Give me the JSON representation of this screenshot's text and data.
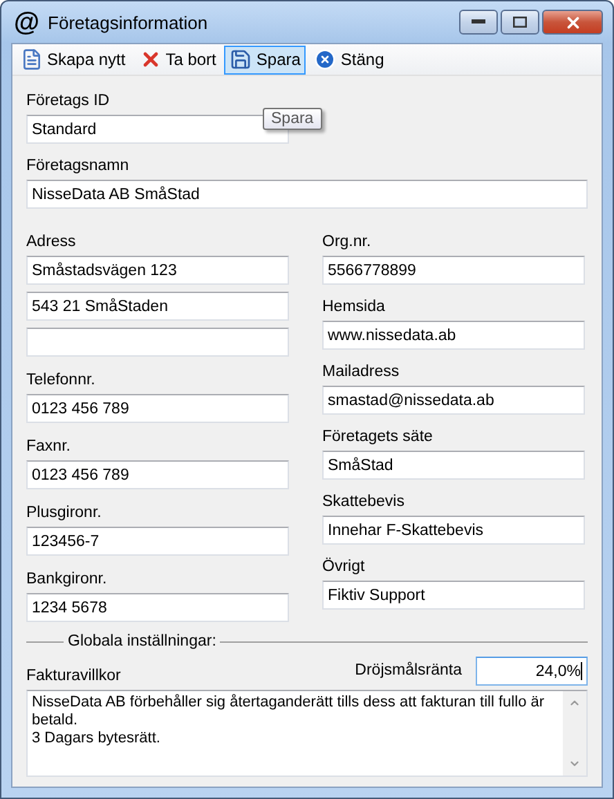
{
  "window": {
    "app_icon": "@",
    "title": "Företagsinformation"
  },
  "toolbar": [
    {
      "kind": "new",
      "label": "Skapa nytt",
      "selected": false
    },
    {
      "kind": "delete",
      "label": "Ta bort",
      "selected": false
    },
    {
      "kind": "save",
      "label": "Spara",
      "selected": true
    },
    {
      "kind": "close",
      "label": "Stäng",
      "selected": false
    }
  ],
  "tooltip": "Spara",
  "company_id": {
    "label": "Företags ID",
    "value": "Standard"
  },
  "company_name": {
    "label": "Företagsnamn",
    "value": "NisseData AB SmåStad"
  },
  "left_fields": [
    {
      "kind": "filled",
      "label": "Adress",
      "value": "Småstadsvägen 123"
    },
    {
      "kind": "filled",
      "value": "543 21 SmåStaden"
    },
    {
      "kind": "blank"
    },
    {
      "kind": "filled",
      "label": "Telefonnr.",
      "value": "0123 456 789"
    },
    {
      "kind": "filled",
      "label": "Faxnr.",
      "value": "0123 456 789"
    },
    {
      "kind": "filled",
      "label": "Plusgironr.",
      "value": "123456-7"
    },
    {
      "kind": "filled",
      "label": "Bankgironr.",
      "value": "1234 5678"
    }
  ],
  "right_fields": [
    {
      "label": "Org.nr.",
      "value": "5566778899"
    },
    {
      "label": "Hemsida",
      "value": "www.nissedata.ab"
    },
    {
      "label": "Mailadress",
      "value": "smastad@nissedata.ab"
    },
    {
      "label": "Företagets säte",
      "value": "SmåStad"
    },
    {
      "label": "Skattebevis",
      "value": "Innehar F-Skattebevis"
    },
    {
      "label": "Övrigt",
      "value": "Fiktiv Support"
    }
  ],
  "global_settings": {
    "title": "Globala inställningar:",
    "invoice_terms": {
      "label": "Fakturavillkor",
      "value": "NisseData AB förbehåller sig återtaganderätt tills dess att fakturan till fullo är betald.\n3 Dagars bytesrätt."
    },
    "late_interest": {
      "label": "Dröjsmålsränta",
      "value": "24,0%",
      "focused": true
    }
  }
}
